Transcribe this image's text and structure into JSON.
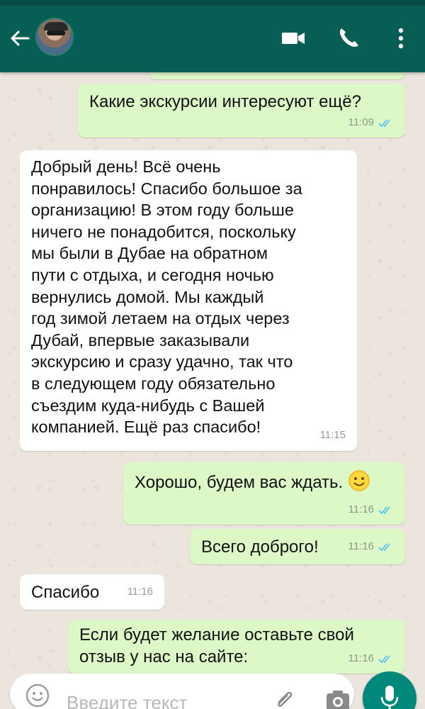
{
  "header": {
    "back_icon": "arrow-left-icon",
    "video_icon": "video-call-icon",
    "call_icon": "phone-icon",
    "menu_icon": "more-vert-icon"
  },
  "messages": [
    {
      "direction": "out",
      "text": "Какие экскурсии интересуют ещё?",
      "time": "11:09",
      "status": "read"
    },
    {
      "direction": "in",
      "lines": [
        "Добрый день! Всё очень",
        "понравилось! Спасибо большое за",
        "организацию! В этом году больше",
        "ничего не понадобится, поскольку",
        "мы были в Дубае на обратном",
        "пути с отдыха, и сегодня ночью",
        "вернулись домой. Мы каждый",
        "год зимой летаем на отдых через",
        "Дубай, впервые заказывали",
        "экскурсию и сразу удачно, так что",
        "в следующем году обязательно",
        "съездим куда-нибудь с Вашей",
        "компанией. Ещё раз спасибо!"
      ],
      "time": "11:15"
    },
    {
      "direction": "out",
      "text": "Хорошо, будем вас ждать.",
      "emoji": "smiling-face",
      "time": "11:16",
      "status": "read"
    },
    {
      "direction": "out",
      "text": "Всего доброго!",
      "time": "11:16",
      "status": "read"
    },
    {
      "direction": "in",
      "text": "Спасибо",
      "time": "11:16"
    },
    {
      "direction": "out",
      "lines": [
        "Если будет желание оставьте свой",
        "отзыв у нас на сайте:"
      ],
      "time": "11:16",
      "status": "read"
    }
  ],
  "composer": {
    "placeholder": "Введите текст",
    "emoji_icon": "smiley-icon",
    "attach_icon": "paperclip-icon",
    "camera_icon": "camera-icon",
    "mic_icon": "microphone-icon"
  },
  "colors": {
    "header": "#075e54",
    "outgoing_bubble": "#dcf8c6",
    "incoming_bubble": "#ffffff",
    "read_ticks": "#4fc3f7",
    "mic_button": "#00897b"
  }
}
